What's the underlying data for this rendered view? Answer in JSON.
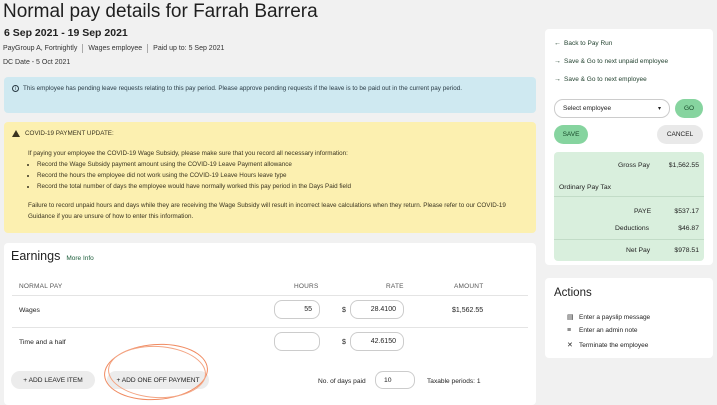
{
  "header": {
    "title": "Normal pay details for Farrah Barrera",
    "date_range": "6 Sep 2021 - 19 Sep 2021",
    "paygroup": "PayGroup A, Fortnightly",
    "employee_type": "Wages employee",
    "paid_up_to": "Paid up to: 5 Sep 2021",
    "dc_date": "DC Date - 5 Oct 2021"
  },
  "alerts": {
    "info_text": "This employee has pending leave requests relating to this pay period. Please approve pending requests if the leave is to be paid out in the current pay period.",
    "covid_title": "COVID-19 PAYMENT UPDATE:",
    "covid_intro": "If paying your employee the COVID-19 Wage Subsidy, please make sure that you record all necessary information:",
    "covid_bullets": [
      "Record the Wage Subsidy payment amount using the COVID-19 Leave Payment allowance",
      "Record the hours the employee did not work using the COVID-19 Leave Hours leave type",
      "Record the total number of days the employee would have normally worked this pay period in the Days Paid field"
    ],
    "covid_footer": "Failure to record unpaid hours and days while they are receiving the Wage Subsidy will result in incorrect leave calculations when they return. Please refer to our COVID-19 Guidance if you are unsure of how to enter this information."
  },
  "earnings": {
    "heading": "Earnings",
    "more_info": "More Info",
    "columns": {
      "normal_pay": "NORMAL PAY",
      "hours": "HOURS",
      "rate": "RATE",
      "amount": "AMOUNT"
    },
    "rows": [
      {
        "name": "Wages",
        "hours": "55",
        "currency": "$",
        "rate": "28.4100",
        "amount": "$1,562.55"
      },
      {
        "name": "Time and a half",
        "hours": "",
        "currency": "$",
        "rate": "42.6150",
        "amount": ""
      }
    ],
    "add_leave": "+ ADD LEAVE ITEM",
    "add_one_off": "+ ADD ONE OFF PAYMENT",
    "days_paid_label": "No. of days paid",
    "days_paid_value": "10",
    "taxable_periods": "Taxable periods: 1"
  },
  "sidebar": {
    "back": "Back to Pay Run",
    "save_next_unpaid": "Save & Go to next unpaid employee",
    "save_next": "Save & Go to next employee",
    "select_placeholder": "Select employee",
    "go": "GO",
    "save": "SAVE",
    "cancel": "CANCEL",
    "summary": {
      "gross_label": "Gross Pay",
      "gross": "$1,562.55",
      "tax_heading": "Ordinary Pay Tax",
      "paye_label": "PAYE",
      "paye": "$537.17",
      "deductions_label": "Deductions",
      "deductions": "$46.87",
      "net_label": "Net Pay",
      "net": "$978.51"
    }
  },
  "actions": {
    "heading": "Actions",
    "items": [
      "Enter a payslip message",
      "Enter an admin note",
      "Terminate the employee"
    ]
  },
  "colors": {
    "accent_green": "#86d49f",
    "info_bg": "#cfe9f1",
    "warning_bg": "#fcf0b0",
    "annotation": "#f08a60"
  }
}
